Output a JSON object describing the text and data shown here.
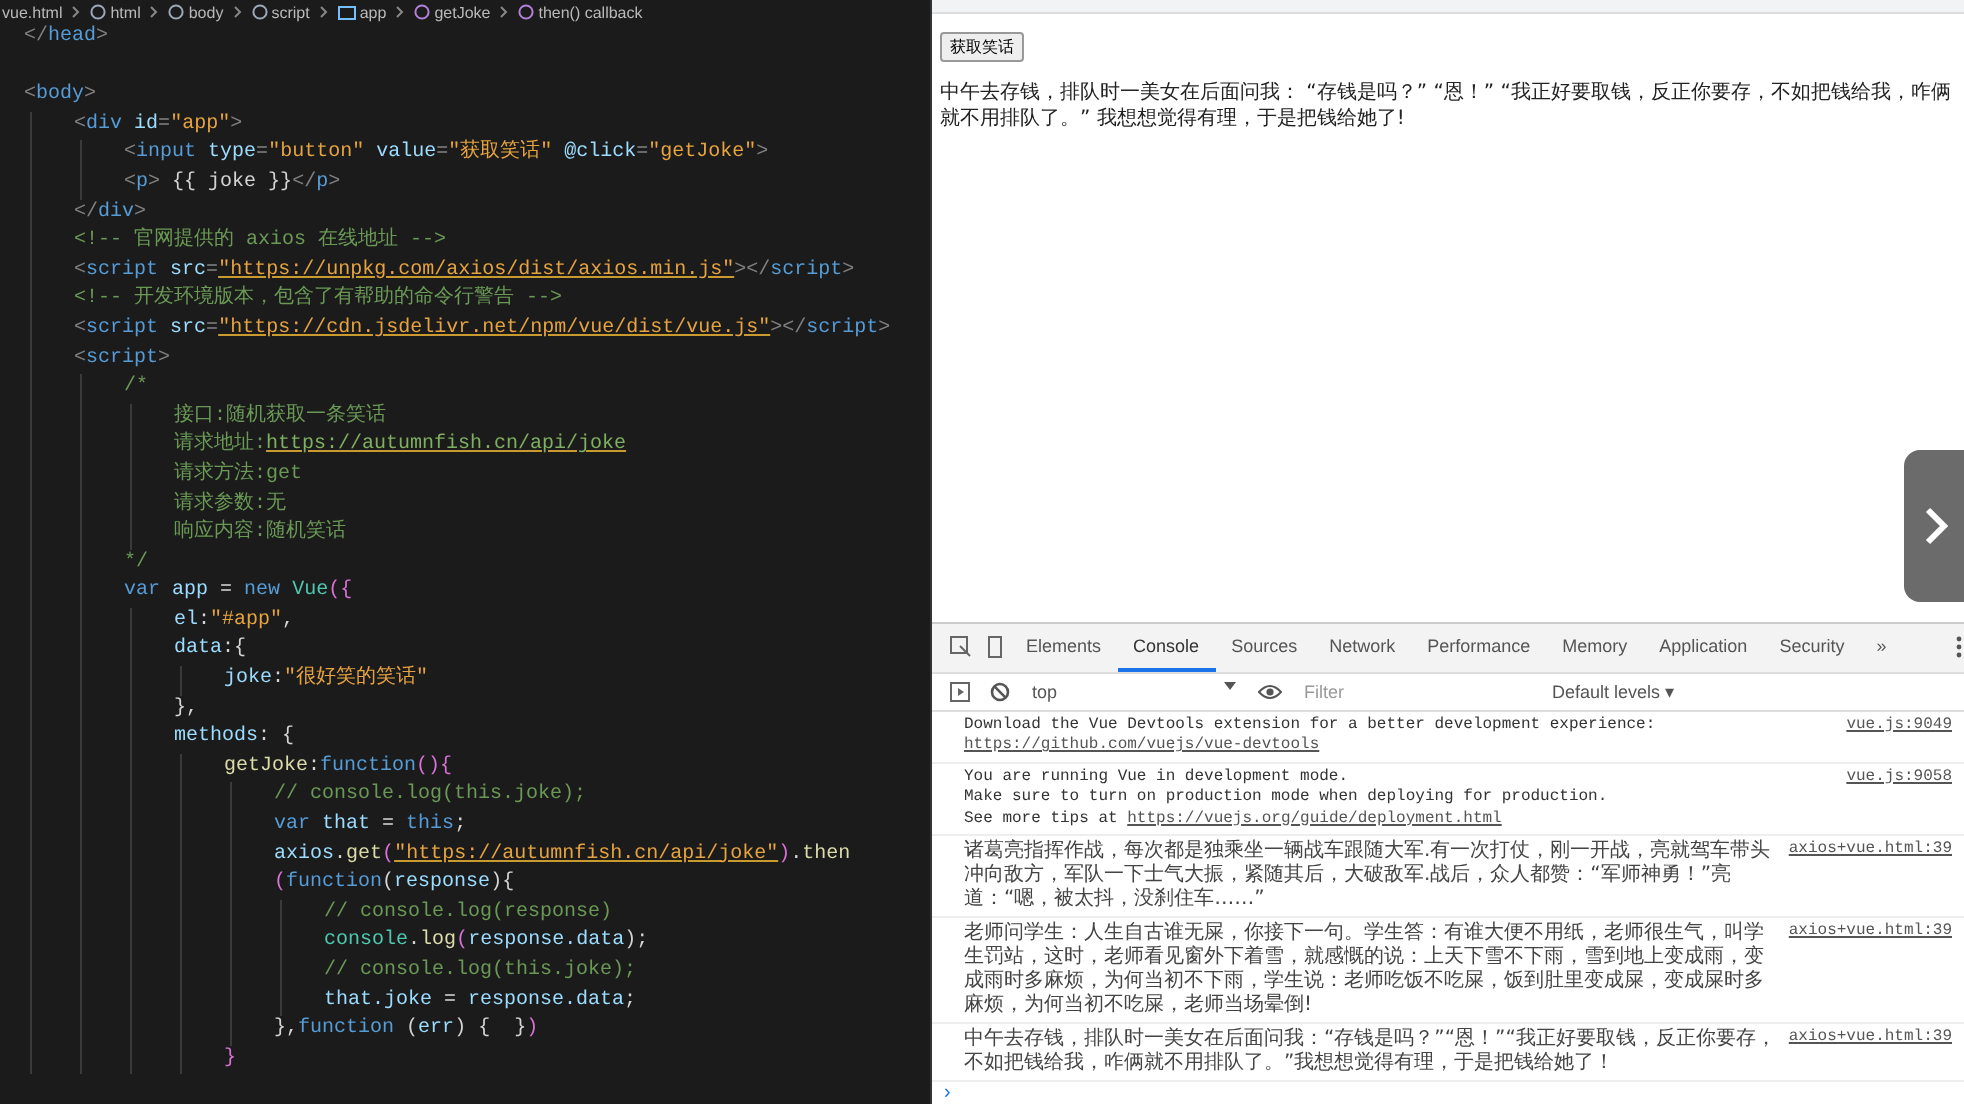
{
  "editor": {
    "breadcrumb": [
      {
        "label": "vue.html",
        "kind": "file"
      },
      {
        "label": "html",
        "kind": "element"
      },
      {
        "label": "body",
        "kind": "element"
      },
      {
        "label": "script",
        "kind": "element"
      },
      {
        "label": "app",
        "kind": "variable"
      },
      {
        "label": "getJoke",
        "kind": "method"
      },
      {
        "label": "then() callback",
        "kind": "method"
      }
    ],
    "lines": [
      {
        "tokens": [
          {
            "t": "</",
            "kind": "punct"
          },
          {
            "t": "head",
            "kind": "tag"
          },
          {
            "t": ">",
            "kind": "punct"
          }
        ]
      },
      {
        "kind": "blank"
      },
      {
        "tokens": [
          {
            "t": "<",
            "kind": "punct"
          },
          {
            "t": "body",
            "kind": "tag"
          },
          {
            "t": ">",
            "kind": "punct"
          }
        ],
        "children": [
          {
            "tokens": [
              {
                "t": "<",
                "kind": "punct"
              },
              {
                "t": "div",
                "kind": "tag"
              },
              {
                "t": " id",
                "kind": "attr"
              },
              {
                "t": "=",
                "kind": "punct"
              },
              {
                "t": "\"app\"",
                "kind": "str"
              },
              {
                "t": ">",
                "kind": "punct"
              }
            ],
            "children": [
              {
                "tokens": [
                  {
                    "t": "<",
                    "kind": "punct"
                  },
                  {
                    "t": "input",
                    "kind": "tag"
                  },
                  {
                    "t": " type",
                    "kind": "attr"
                  },
                  {
                    "t": "=",
                    "kind": "punct"
                  },
                  {
                    "t": "\"button\"",
                    "kind": "str"
                  },
                  {
                    "t": " value",
                    "kind": "attr"
                  },
                  {
                    "t": "=",
                    "kind": "punct"
                  },
                  {
                    "t": "\"获取笑话\"",
                    "kind": "str"
                  },
                  {
                    "t": " @click",
                    "kind": "attr"
                  },
                  {
                    "t": "=",
                    "kind": "punct"
                  },
                  {
                    "t": "\"getJoke\"",
                    "kind": "str"
                  },
                  {
                    "t": ">",
                    "kind": "punct"
                  }
                ]
              },
              {
                "tokens": [
                  {
                    "t": "<",
                    "kind": "punct"
                  },
                  {
                    "t": "p",
                    "kind": "tag"
                  },
                  {
                    "t": ">",
                    "kind": "punct"
                  },
                  {
                    "t": " {{ joke }}",
                    "kind": "text"
                  },
                  {
                    "t": "</",
                    "kind": "punct"
                  },
                  {
                    "t": "p",
                    "kind": "tag"
                  },
                  {
                    "t": ">",
                    "kind": "punct"
                  }
                ]
              }
            ]
          },
          {
            "tokens": [
              {
                "t": "</",
                "kind": "punct"
              },
              {
                "t": "div",
                "kind": "tag"
              },
              {
                "t": ">",
                "kind": "punct"
              }
            ]
          },
          {
            "tokens": [
              {
                "t": "<!-- 官网提供的 axios 在线地址 -->",
                "kind": "cmt"
              }
            ]
          },
          {
            "tokens": [
              {
                "t": "<",
                "kind": "punct"
              },
              {
                "t": "script",
                "kind": "tag"
              },
              {
                "t": " src",
                "kind": "attr"
              },
              {
                "t": "=",
                "kind": "punct"
              },
              {
                "t": "\"https://unpkg.com/axios/dist/axios.min.js\"",
                "kind": "url"
              },
              {
                "t": "></",
                "kind": "punct"
              },
              {
                "t": "script",
                "kind": "tag"
              },
              {
                "t": ">",
                "kind": "punct"
              }
            ]
          },
          {
            "tokens": [
              {
                "t": "<!-- 开发环境版本，包含了有帮助的命令行警告 -->",
                "kind": "cmt"
              }
            ]
          },
          {
            "tokens": [
              {
                "t": "<",
                "kind": "punct"
              },
              {
                "t": "script",
                "kind": "tag"
              },
              {
                "t": " src",
                "kind": "attr"
              },
              {
                "t": "=",
                "kind": "punct"
              },
              {
                "t": "\"https://cdn.jsdelivr.net/npm/vue/dist/vue.js\"",
                "kind": "url"
              },
              {
                "t": "></",
                "kind": "punct"
              },
              {
                "t": "script",
                "kind": "tag"
              },
              {
                "t": ">",
                "kind": "punct"
              }
            ]
          },
          {
            "tokens": [
              {
                "t": "<",
                "kind": "punct"
              },
              {
                "t": "script",
                "kind": "tag"
              },
              {
                "t": ">",
                "kind": "punct"
              }
            ],
            "children": [
              {
                "tokens": [
                  {
                    "t": "/*",
                    "kind": "cmt"
                  }
                ],
                "children": [
                  {
                    "tokens": [
                      {
                        "t": "接口:随机获取一条笑话",
                        "kind": "cmt"
                      }
                    ]
                  },
                  {
                    "tokens": [
                      {
                        "t": "请求地址:",
                        "kind": "cmt"
                      },
                      {
                        "t": "https://autumnfish.cn/api/joke",
                        "kind": "cmturl"
                      }
                    ]
                  },
                  {
                    "tokens": [
                      {
                        "t": "请求方法:get",
                        "kind": "cmt"
                      }
                    ]
                  },
                  {
                    "tokens": [
                      {
                        "t": "请求参数:无",
                        "kind": "cmt"
                      }
                    ]
                  },
                  {
                    "tokens": [
                      {
                        "t": "响应内容:随机笑话",
                        "kind": "cmt"
                      }
                    ]
                  }
                ]
              },
              {
                "tokens": [
                  {
                    "t": "*/",
                    "kind": "cmt"
                  }
                ]
              },
              {
                "tokens": [
                  {
                    "t": "var",
                    "kind": "kw"
                  },
                  {
                    "t": " app",
                    "kind": "var"
                  },
                  {
                    "t": " = ",
                    "kind": "text"
                  },
                  {
                    "t": "new",
                    "kind": "kw"
                  },
                  {
                    "t": " Vue",
                    "kind": "cls"
                  },
                  {
                    "t": "({",
                    "kind": "brace"
                  }
                ],
                "children": [
                  {
                    "tokens": [
                      {
                        "t": "el",
                        "kind": "var"
                      },
                      {
                        "t": ":",
                        "kind": "text"
                      },
                      {
                        "t": "\"#app\"",
                        "kind": "str"
                      },
                      {
                        "t": ",",
                        "kind": "text"
                      }
                    ]
                  },
                  {
                    "tokens": [
                      {
                        "t": "data",
                        "kind": "var"
                      },
                      {
                        "t": ":{",
                        "kind": "text"
                      }
                    ],
                    "children": [
                      {
                        "tokens": [
                          {
                            "t": "joke",
                            "kind": "var"
                          },
                          {
                            "t": ":",
                            "kind": "text"
                          },
                          {
                            "t": "\"很好笑的笑话\"",
                            "kind": "str"
                          }
                        ]
                      }
                    ]
                  },
                  {
                    "tokens": [
                      {
                        "t": "},",
                        "kind": "text"
                      }
                    ]
                  },
                  {
                    "tokens": [
                      {
                        "t": "methods",
                        "kind": "var"
                      },
                      {
                        "t": ": {",
                        "kind": "text"
                      }
                    ],
                    "children": [
                      {
                        "tokens": [
                          {
                            "t": "getJoke",
                            "kind": "fn"
                          },
                          {
                            "t": ":",
                            "kind": "text"
                          },
                          {
                            "t": "function",
                            "kind": "kw"
                          },
                          {
                            "t": "(){",
                            "kind": "brace"
                          }
                        ],
                        "children": [
                          {
                            "tokens": [
                              {
                                "t": "// console.log(this.joke);",
                                "kind": "cmt"
                              }
                            ]
                          },
                          {
                            "tokens": [
                              {
                                "t": "var",
                                "kind": "kw"
                              },
                              {
                                "t": " that",
                                "kind": "var"
                              },
                              {
                                "t": " = ",
                                "kind": "text"
                              },
                              {
                                "t": "this",
                                "kind": "kw"
                              },
                              {
                                "t": ";",
                                "kind": "text"
                              }
                            ]
                          },
                          {
                            "tokens": [
                              {
                                "t": "axios",
                                "kind": "var"
                              },
                              {
                                "t": ".",
                                "kind": "text"
                              },
                              {
                                "t": "get",
                                "kind": "fn"
                              },
                              {
                                "t": "(",
                                "kind": "brace"
                              },
                              {
                                "t": "\"https://autumnfish.cn/api/joke\"",
                                "kind": "url"
                              },
                              {
                                "t": ")",
                                "kind": "brace"
                              },
                              {
                                "t": ".",
                                "kind": "text"
                              },
                              {
                                "t": "then",
                                "kind": "fn"
                              }
                            ]
                          },
                          {
                            "tokens": [
                              {
                                "t": "(",
                                "kind": "brace"
                              },
                              {
                                "t": "function",
                                "kind": "kw"
                              },
                              {
                                "t": "(",
                                "kind": "text"
                              },
                              {
                                "t": "response",
                                "kind": "var"
                              },
                              {
                                "t": "){",
                                "kind": "text"
                              }
                            ],
                            "children": [
                              {
                                "tokens": [
                                  {
                                    "t": "// console.log(response)",
                                    "kind": "cmt"
                                  }
                                ]
                              },
                              {
                                "tokens": [
                                  {
                                    "t": "console",
                                    "kind": "cls"
                                  },
                                  {
                                    "t": ".",
                                    "kind": "text"
                                  },
                                  {
                                    "t": "log",
                                    "kind": "fn"
                                  },
                                  {
                                    "t": "(",
                                    "kind": "brace"
                                  },
                                  {
                                    "t": "response.data",
                                    "kind": "var"
                                  },
                                  {
                                    "t": ");",
                                    "kind": "text"
                                  }
                                ]
                              },
                              {
                                "tokens": [
                                  {
                                    "t": "// console.log(this.joke);",
                                    "kind": "cmt"
                                  }
                                ]
                              },
                              {
                                "tokens": [
                                  {
                                    "t": "that.joke",
                                    "kind": "var"
                                  },
                                  {
                                    "t": " = ",
                                    "kind": "text"
                                  },
                                  {
                                    "t": "response.data",
                                    "kind": "var"
                                  },
                                  {
                                    "t": ";",
                                    "kind": "text"
                                  }
                                ]
                              }
                            ]
                          },
                          {
                            "tokens": [
                              {
                                "t": "},",
                                "kind": "text"
                              },
                              {
                                "t": "function",
                                "kind": "kw"
                              },
                              {
                                "t": " (",
                                "kind": "text"
                              },
                              {
                                "t": "err",
                                "kind": "var"
                              },
                              {
                                "t": ") {  }",
                                "kind": "text"
                              },
                              {
                                "t": ")",
                                "kind": "brace"
                              }
                            ]
                          }
                        ]
                      },
                      {
                        "tokens": [
                          {
                            "t": "}",
                            "kind": "brace"
                          }
                        ]
                      }
                    ]
                  }
                ]
              }
            ]
          }
        ]
      }
    ]
  },
  "page": {
    "button": "获取笑话",
    "joke": "中午去存钱，排队时一美女在后面问我： “存钱是吗？” “恩！” “我正好要取钱，反正你要存，不如把钱给我，咋俩就不用排队了。” 我想想觉得有理，于是把钱给她了!"
  },
  "devtools": {
    "tabs": [
      {
        "label": "Elements",
        "selected": false
      },
      {
        "label": "Console",
        "selected": true
      },
      {
        "label": "Sources",
        "selected": false
      },
      {
        "label": "Network",
        "selected": false
      },
      {
        "label": "Performance",
        "selected": false
      },
      {
        "label": "Memory",
        "selected": false
      },
      {
        "label": "Application",
        "selected": false
      },
      {
        "label": "Security",
        "selected": false
      }
    ],
    "more": "»",
    "context": "top",
    "filter_placeholder": "Filter",
    "levels": "Default levels ▾",
    "messages": [
      {
        "kind": "log",
        "source": "vue.js:9049",
        "lines": [
          [
            {
              "t": "Download the Vue Devtools extension for a better development experience:",
              "kind": "text"
            }
          ],
          [
            {
              "t": "https://github.com/vuejs/vue-devtools",
              "kind": "link"
            }
          ]
        ]
      },
      {
        "kind": "log",
        "source": "vue.js:9058",
        "lines": [
          [
            {
              "t": "You are running Vue in development mode.",
              "kind": "text"
            }
          ],
          [
            {
              "t": "Make sure to turn on production mode when deploying for production.",
              "kind": "text"
            }
          ],
          [
            {
              "t": "See more tips at ",
              "kind": "text"
            },
            {
              "t": "https://vuejs.org/guide/deployment.html",
              "kind": "link"
            }
          ]
        ]
      },
      {
        "kind": "wrap",
        "source": "axios+vue.html:39",
        "text": "诸葛亮指挥作战，每次都是独乘坐一辆战车跟随大军.有一次打仗，刚一开战，亮就驾车带头冲向敌方，军队一下士气大振，紧随其后，大破敌军.战后，众人都赞：“军师神勇！”亮道：“嗯，被太抖，没刹住车……”"
      },
      {
        "kind": "wrap",
        "source": "axios+vue.html:39",
        "text": "老师问学生：人生自古谁无屎，你接下一句。学生答：有谁大便不用纸，老师很生气，叫学生罚站，这时，老师看见窗外下着雪，就感慨的说：上天下雪不下雨，雪到地上变成雨，变成雨时多麻烦，为何当初不下雨，学生说：老师吃饭不吃屎，饭到肚里变成屎，变成屎时多麻烦，为何当初不吃屎，老师当场晕倒!"
      },
      {
        "kind": "wrap",
        "source": "axios+vue.html:39",
        "text": "中午去存钱，排队时一美女在后面问我：“存钱是吗？”“恩！”“我正好要取钱，反正你要存，不如把钱给我，咋俩就不用排队了。”我想想觉得有理，于是把钱给她了！"
      }
    ],
    "prompt": "›"
  }
}
